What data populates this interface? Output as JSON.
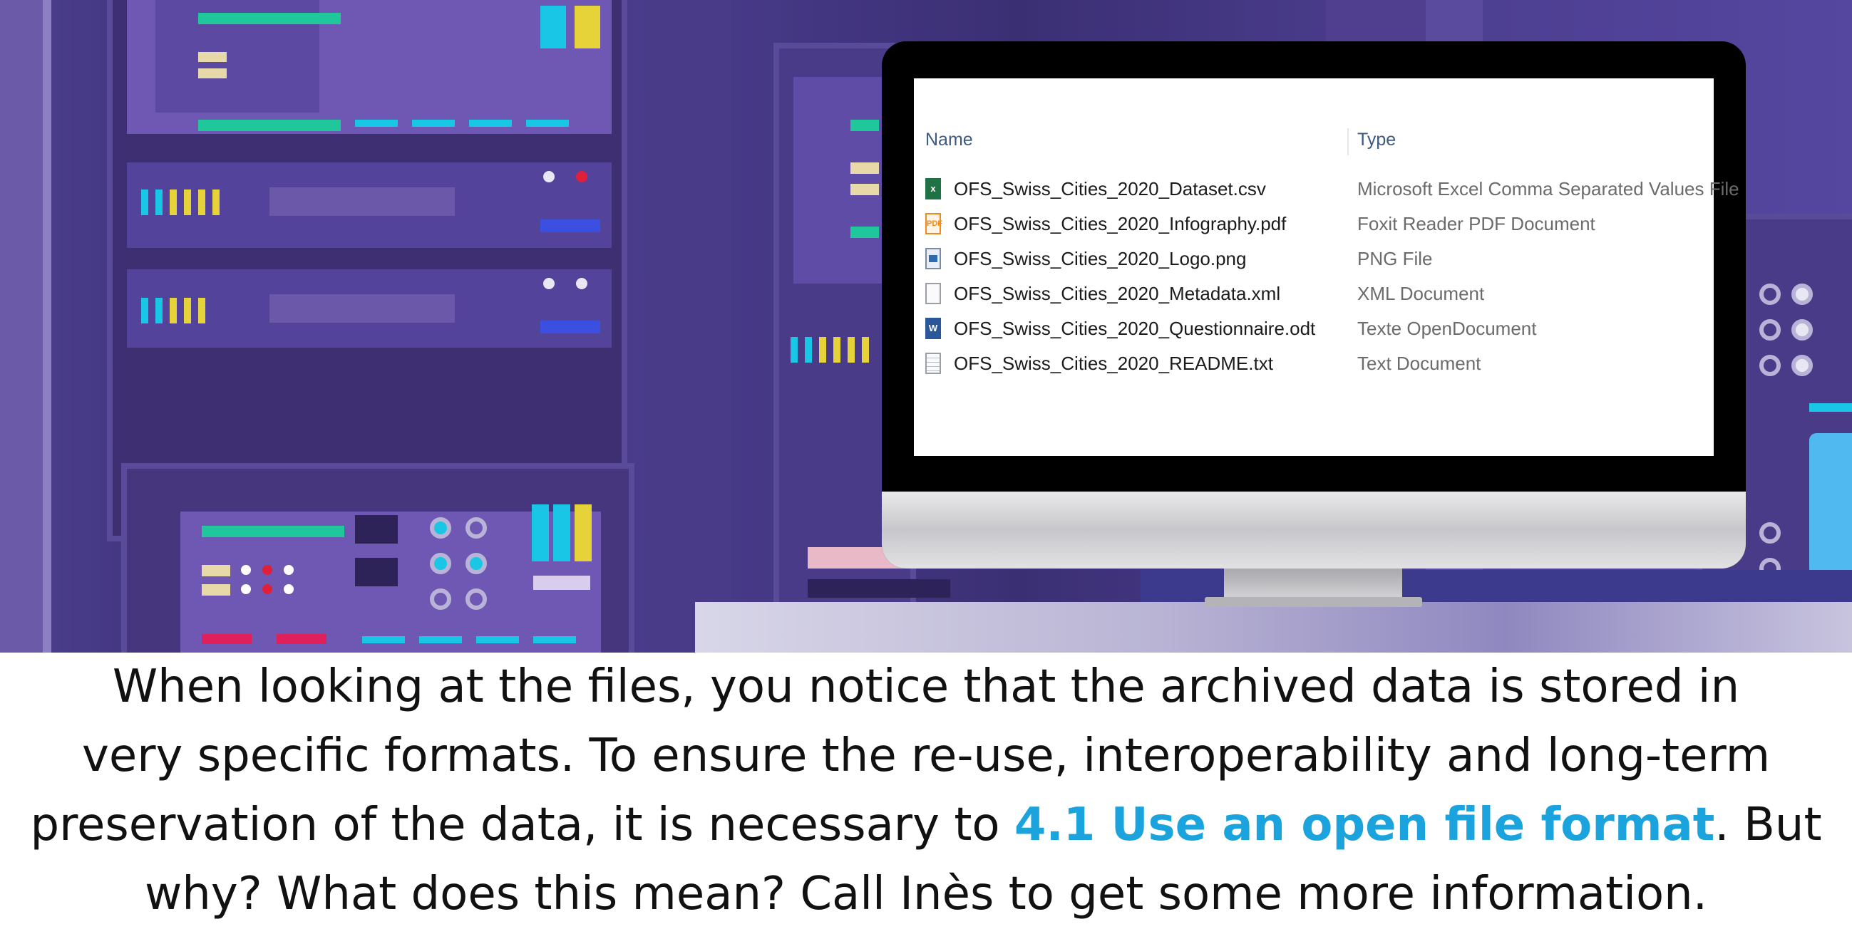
{
  "explorer": {
    "columns": {
      "name": "Name",
      "type": "Type"
    },
    "files": [
      {
        "name": "OFS_Swiss_Cities_2020_Dataset.csv",
        "type": "Microsoft Excel Comma Separated Values File",
        "icon": "excel-csv-icon",
        "color": "#1f7244"
      },
      {
        "name": "OFS_Swiss_Cities_2020_Infography.pdf",
        "type": "Foxit Reader PDF Document",
        "icon": "pdf-icon",
        "color": "#f08a1c"
      },
      {
        "name": "OFS_Swiss_Cities_2020_Logo.png",
        "type": "PNG File",
        "icon": "image-file-icon",
        "color": "#2b6cb0"
      },
      {
        "name": "OFS_Swiss_Cities_2020_Metadata.xml",
        "type": "XML Document",
        "icon": "blank-file-icon",
        "color": "#9aa0a6"
      },
      {
        "name": "OFS_Swiss_Cities_2020_Questionnaire.odt",
        "type": "Texte OpenDocument",
        "icon": "word-document-icon",
        "color": "#2b579a"
      },
      {
        "name": "OFS_Swiss_Cities_2020_README.txt",
        "type": "Text Document",
        "icon": "text-file-icon",
        "color": "#9aa0a6"
      }
    ]
  },
  "caption": {
    "line1": "When looking at the files, you notice that the archived data is stored in",
    "line2": "very specific formats. To ensure the re-use, interoperability and long-term",
    "line3_before": "preservation of the data, it is necessary to ",
    "link": "4.1 Use an open file format",
    "line3_after": ". But",
    "line4": "why? What does this mean? Call Inès to get some more information.",
    "link_color": "#1aa3dc"
  }
}
